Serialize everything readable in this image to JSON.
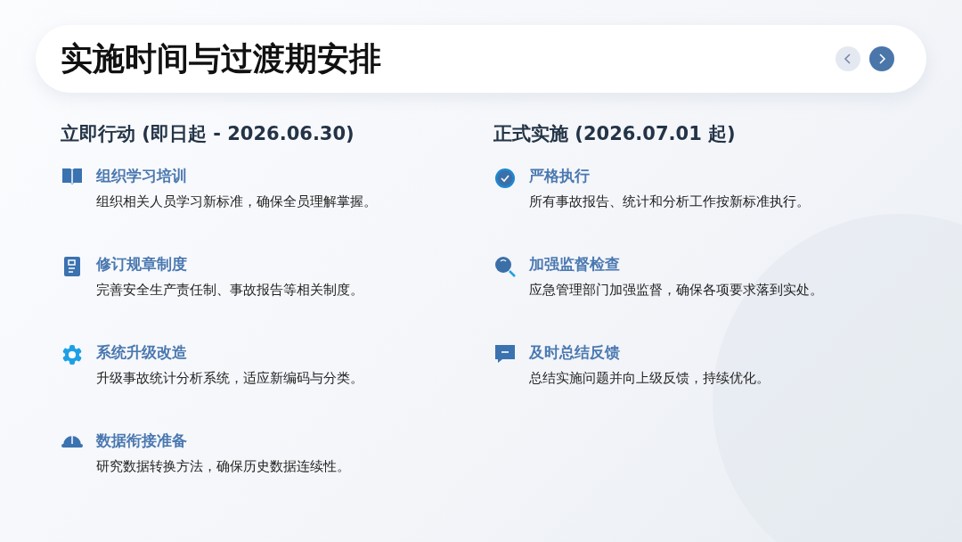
{
  "header": {
    "title": "实施时间与过渡期安排",
    "nav": [
      {
        "kind": "prev",
        "disabled": true
      },
      {
        "kind": "next",
        "disabled": false
      }
    ]
  },
  "columns": [
    {
      "heading": "立即行动 (即日起 - 2026.06.30)",
      "items": [
        {
          "kind": "book",
          "title": "组织学习培训",
          "text": "组织相关人员学习新标准，确保全员理解掌握。"
        },
        {
          "kind": "document",
          "title": "修订规章制度",
          "text": "完善安全生产责任制、事故报告等相关制度。"
        },
        {
          "kind": "gear",
          "title": "系统升级改造",
          "text": "升级事故统计分析系统，适应新编码与分类。"
        },
        {
          "kind": "helmet",
          "title": "数据衔接准备",
          "text": "研究数据转换方法，确保历史数据连续性。"
        }
      ]
    },
    {
      "heading": "正式实施 (2026.07.01 起)",
      "items": [
        {
          "kind": "check",
          "title": "严格执行",
          "text": "所有事故报告、统计和分析工作按新标准执行。"
        },
        {
          "kind": "search",
          "title": "加强监督检查",
          "text": "应急管理部门加强监督，确保各项要求落到实处。"
        },
        {
          "kind": "chat",
          "title": "及时总结反馈",
          "text": "总结实施问题并向上级反馈，持续优化。"
        }
      ]
    }
  ]
}
